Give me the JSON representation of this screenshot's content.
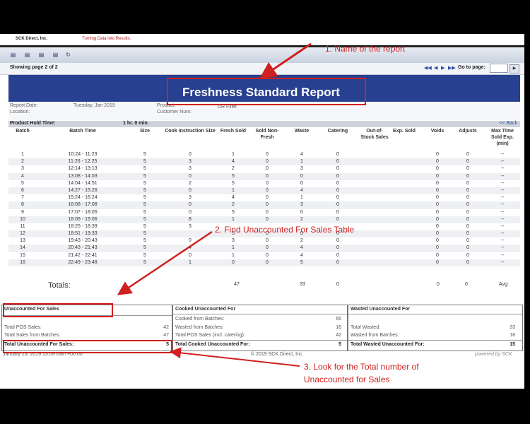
{
  "app": {
    "logo": "SCK Direct, Inc.",
    "tagline": "Turning Data Into Results."
  },
  "pager": {
    "showing": "Showing page  2  of  2",
    "goto_label": "Go to page:",
    "goto_value": ""
  },
  "report": {
    "title": "Freshness Standard Report",
    "date_label": "Report Date:",
    "date_value": "Tuesday, Jan      2019",
    "location_label": "Location:",
    "product_label": "Product:",
    "product_value": "DR Fillet",
    "customer_label": "Customer Num:",
    "hold_label": "Product Hold Time:",
    "hold_value": "1 hr. 0 min.",
    "back_link": "<< Back"
  },
  "table": {
    "headers": [
      "Batch",
      "Batch Time",
      "Size",
      "Cook Instruction Size",
      "Fresh Sold",
      "Sold Non-Fresh",
      "Waste",
      "Catering",
      "Out-of-Stock Sales",
      "Exp. Sold",
      "Voids",
      "Adjusts",
      "Max Time Sold Exp. (min)"
    ],
    "rows": [
      [
        "1",
        "10:24 - 11:23",
        "5",
        "0",
        "1",
        "0",
        "4",
        "0",
        "",
        "",
        "0",
        "0",
        "--"
      ],
      [
        "2",
        "11:26 - 12:25",
        "5",
        "3",
        "4",
        "0",
        "1",
        "0",
        "",
        "",
        "0",
        "0",
        "--"
      ],
      [
        "3",
        "12:14 - 13:13",
        "5",
        "3",
        "2",
        "0",
        "3",
        "0",
        "",
        "",
        "0",
        "0",
        "--"
      ],
      [
        "4",
        "13:08 - 14:03",
        "5",
        "0",
        "5",
        "0",
        "0",
        "0",
        "",
        "",
        "0",
        "0",
        "--"
      ],
      [
        "5",
        "14:04 - 14:51",
        "5",
        "2",
        "5",
        "0",
        "0",
        "0",
        "",
        "",
        "0",
        "0",
        "--"
      ],
      [
        "6",
        "14:27 - 15:26",
        "5",
        "0",
        "1",
        "0",
        "4",
        "0",
        "",
        "",
        "0",
        "0",
        "--"
      ],
      [
        "7",
        "15:24 - 16:24",
        "5",
        "3",
        "4",
        "0",
        "1",
        "0",
        "",
        "",
        "0",
        "0",
        "--"
      ],
      [
        "8",
        "16:08 - 17:08",
        "5",
        "0",
        "2",
        "0",
        "3",
        "0",
        "",
        "",
        "0",
        "0",
        "--"
      ],
      [
        "9",
        "17:07 - 18:05",
        "5",
        "0",
        "5",
        "0",
        "0",
        "0",
        "",
        "",
        "0",
        "0",
        "--"
      ],
      [
        "10",
        "18:06 - 19:06",
        "5",
        "8",
        "1",
        "0",
        "2",
        "0",
        "",
        "",
        "0",
        "0",
        "--"
      ],
      [
        "11",
        "18:25 - 18:39",
        "5",
        "3",
        "",
        "",
        "",
        "",
        "",
        "",
        "0",
        "0",
        "--"
      ],
      [
        "12",
        "18:51 - 19:33",
        "5",
        "",
        "5",
        "0",
        "0",
        "0",
        "",
        "",
        "0",
        "0",
        "--"
      ],
      [
        "13",
        "19:43 - 20:43",
        "5",
        "0",
        "3",
        "0",
        "2",
        "0",
        "",
        "",
        "0",
        "0",
        "--"
      ],
      [
        "14",
        "20:43 - 21:43",
        "5",
        "4",
        "1",
        "0",
        "4",
        "0",
        "",
        "",
        "0",
        "0",
        "--"
      ],
      [
        "15",
        "21:42 - 22:41",
        "5",
        "0",
        "1",
        "0",
        "4",
        "0",
        "",
        "",
        "0",
        "0",
        "--"
      ],
      [
        "16",
        "22:49 - 23:48",
        "5",
        "1",
        "0",
        "0",
        "5",
        "0",
        "",
        "",
        "0",
        "0",
        "--"
      ]
    ],
    "totals_label": "Totals:",
    "totals": {
      "fresh_sold": "47",
      "waste": "33",
      "catering": "0",
      "voids": "0",
      "adjusts": "0",
      "max": "Avg:"
    }
  },
  "unaccounted": {
    "title": "Unaccounted For Sales",
    "pos_label": "Total POS Sales:",
    "pos_value": "42",
    "batches_label": "Total Sales from Batches:",
    "batches_value": "47",
    "total_label": "Total Unaccounted For Sales:",
    "total_value": "5"
  },
  "cooked": {
    "title": "Cooked Unaccounted For",
    "from_batches_label": "Cooked from Batches:",
    "from_batches_value": "65",
    "wasted_label": "Wasted from Batches:",
    "wasted_value": "18",
    "pos_label": "Total POS Sales (incl. catering):",
    "pos_value": "42",
    "total_label": "Total Cooked Unaccounted For:",
    "total_value": "5"
  },
  "wasted": {
    "title": "Wasted Unaccounted For",
    "total_wasted_label": "Total Wasted:",
    "total_wasted_value": "33",
    "from_batches_label": "Wasted from Batches:",
    "from_batches_value": "18",
    "total_label": "Total Wasted Unaccounted For:",
    "total_value": "15"
  },
  "footer": {
    "timestamp": "January 23, 2019 13:09 GMT+00:00",
    "copyright": "© 2019 SCK Direct, Inc.",
    "powered": "powered by SCK"
  },
  "annotations": {
    "a1": "1. Name of the report",
    "a2": "2. Find Unaccounted For Sales Table",
    "a3_line1": "3. Look for the Total number of",
    "a3_line2": "Unaccounted for Sales"
  },
  "colors": {
    "accent": "#d02020",
    "header_blue": "#27408f"
  }
}
